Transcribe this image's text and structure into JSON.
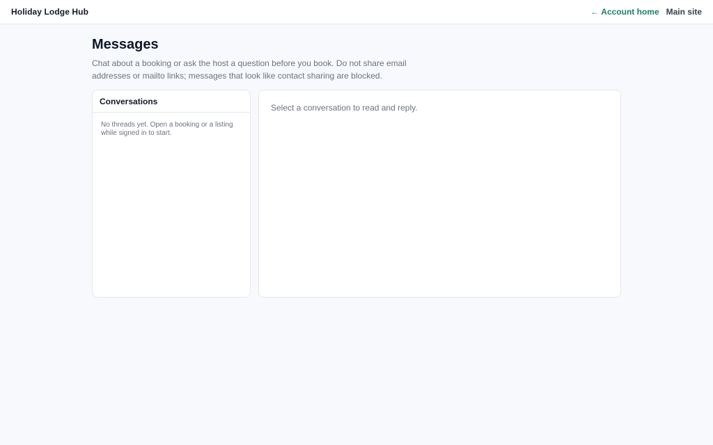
{
  "header": {
    "brand": "Holiday Lodge Hub",
    "nav": {
      "account_arrow": "←",
      "account_home": "Account home",
      "main_site": "Main site"
    }
  },
  "page": {
    "title": "Messages",
    "subtitle": "Chat about a booking or ask the host a question before you book. Do not share email addresses or mailto links; messages that look like contact sharing are blocked."
  },
  "conversations": {
    "heading": "Conversations",
    "empty_text": "No threads yet. Open a booking or a listing while signed in to start."
  },
  "thread": {
    "placeholder": "Select a conversation to read and reply."
  },
  "colors": {
    "accent": "#1b7f6e",
    "background": "#f7f9fc",
    "card": "#ffffff",
    "border": "#e5e7eb",
    "muted_text": "#6b7280"
  },
  "icons": {
    "back_arrow": "left-arrow-icon"
  }
}
